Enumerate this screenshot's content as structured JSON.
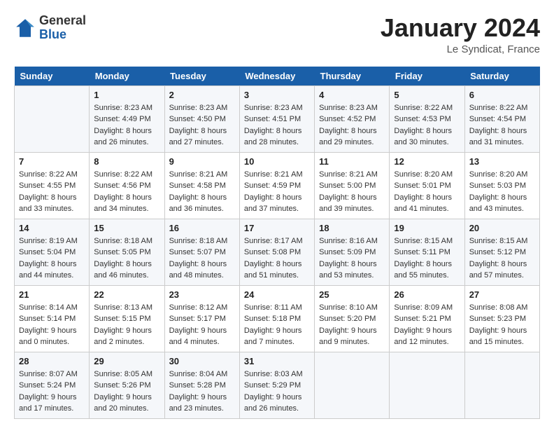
{
  "header": {
    "logo_general": "General",
    "logo_blue": "Blue",
    "month_title": "January 2024",
    "location": "Le Syndicat, France"
  },
  "weekdays": [
    "Sunday",
    "Monday",
    "Tuesday",
    "Wednesday",
    "Thursday",
    "Friday",
    "Saturday"
  ],
  "weeks": [
    [
      {
        "day": "",
        "sunrise": "",
        "sunset": "",
        "daylight": ""
      },
      {
        "day": "1",
        "sunrise": "Sunrise: 8:23 AM",
        "sunset": "Sunset: 4:49 PM",
        "daylight": "Daylight: 8 hours and 26 minutes."
      },
      {
        "day": "2",
        "sunrise": "Sunrise: 8:23 AM",
        "sunset": "Sunset: 4:50 PM",
        "daylight": "Daylight: 8 hours and 27 minutes."
      },
      {
        "day": "3",
        "sunrise": "Sunrise: 8:23 AM",
        "sunset": "Sunset: 4:51 PM",
        "daylight": "Daylight: 8 hours and 28 minutes."
      },
      {
        "day": "4",
        "sunrise": "Sunrise: 8:23 AM",
        "sunset": "Sunset: 4:52 PM",
        "daylight": "Daylight: 8 hours and 29 minutes."
      },
      {
        "day": "5",
        "sunrise": "Sunrise: 8:22 AM",
        "sunset": "Sunset: 4:53 PM",
        "daylight": "Daylight: 8 hours and 30 minutes."
      },
      {
        "day": "6",
        "sunrise": "Sunrise: 8:22 AM",
        "sunset": "Sunset: 4:54 PM",
        "daylight": "Daylight: 8 hours and 31 minutes."
      }
    ],
    [
      {
        "day": "7",
        "sunrise": "Sunrise: 8:22 AM",
        "sunset": "Sunset: 4:55 PM",
        "daylight": "Daylight: 8 hours and 33 minutes."
      },
      {
        "day": "8",
        "sunrise": "Sunrise: 8:22 AM",
        "sunset": "Sunset: 4:56 PM",
        "daylight": "Daylight: 8 hours and 34 minutes."
      },
      {
        "day": "9",
        "sunrise": "Sunrise: 8:21 AM",
        "sunset": "Sunset: 4:58 PM",
        "daylight": "Daylight: 8 hours and 36 minutes."
      },
      {
        "day": "10",
        "sunrise": "Sunrise: 8:21 AM",
        "sunset": "Sunset: 4:59 PM",
        "daylight": "Daylight: 8 hours and 37 minutes."
      },
      {
        "day": "11",
        "sunrise": "Sunrise: 8:21 AM",
        "sunset": "Sunset: 5:00 PM",
        "daylight": "Daylight: 8 hours and 39 minutes."
      },
      {
        "day": "12",
        "sunrise": "Sunrise: 8:20 AM",
        "sunset": "Sunset: 5:01 PM",
        "daylight": "Daylight: 8 hours and 41 minutes."
      },
      {
        "day": "13",
        "sunrise": "Sunrise: 8:20 AM",
        "sunset": "Sunset: 5:03 PM",
        "daylight": "Daylight: 8 hours and 43 minutes."
      }
    ],
    [
      {
        "day": "14",
        "sunrise": "Sunrise: 8:19 AM",
        "sunset": "Sunset: 5:04 PM",
        "daylight": "Daylight: 8 hours and 44 minutes."
      },
      {
        "day": "15",
        "sunrise": "Sunrise: 8:18 AM",
        "sunset": "Sunset: 5:05 PM",
        "daylight": "Daylight: 8 hours and 46 minutes."
      },
      {
        "day": "16",
        "sunrise": "Sunrise: 8:18 AM",
        "sunset": "Sunset: 5:07 PM",
        "daylight": "Daylight: 8 hours and 48 minutes."
      },
      {
        "day": "17",
        "sunrise": "Sunrise: 8:17 AM",
        "sunset": "Sunset: 5:08 PM",
        "daylight": "Daylight: 8 hours and 51 minutes."
      },
      {
        "day": "18",
        "sunrise": "Sunrise: 8:16 AM",
        "sunset": "Sunset: 5:09 PM",
        "daylight": "Daylight: 8 hours and 53 minutes."
      },
      {
        "day": "19",
        "sunrise": "Sunrise: 8:15 AM",
        "sunset": "Sunset: 5:11 PM",
        "daylight": "Daylight: 8 hours and 55 minutes."
      },
      {
        "day": "20",
        "sunrise": "Sunrise: 8:15 AM",
        "sunset": "Sunset: 5:12 PM",
        "daylight": "Daylight: 8 hours and 57 minutes."
      }
    ],
    [
      {
        "day": "21",
        "sunrise": "Sunrise: 8:14 AM",
        "sunset": "Sunset: 5:14 PM",
        "daylight": "Daylight: 9 hours and 0 minutes."
      },
      {
        "day": "22",
        "sunrise": "Sunrise: 8:13 AM",
        "sunset": "Sunset: 5:15 PM",
        "daylight": "Daylight: 9 hours and 2 minutes."
      },
      {
        "day": "23",
        "sunrise": "Sunrise: 8:12 AM",
        "sunset": "Sunset: 5:17 PM",
        "daylight": "Daylight: 9 hours and 4 minutes."
      },
      {
        "day": "24",
        "sunrise": "Sunrise: 8:11 AM",
        "sunset": "Sunset: 5:18 PM",
        "daylight": "Daylight: 9 hours and 7 minutes."
      },
      {
        "day": "25",
        "sunrise": "Sunrise: 8:10 AM",
        "sunset": "Sunset: 5:20 PM",
        "daylight": "Daylight: 9 hours and 9 minutes."
      },
      {
        "day": "26",
        "sunrise": "Sunrise: 8:09 AM",
        "sunset": "Sunset: 5:21 PM",
        "daylight": "Daylight: 9 hours and 12 minutes."
      },
      {
        "day": "27",
        "sunrise": "Sunrise: 8:08 AM",
        "sunset": "Sunset: 5:23 PM",
        "daylight": "Daylight: 9 hours and 15 minutes."
      }
    ],
    [
      {
        "day": "28",
        "sunrise": "Sunrise: 8:07 AM",
        "sunset": "Sunset: 5:24 PM",
        "daylight": "Daylight: 9 hours and 17 minutes."
      },
      {
        "day": "29",
        "sunrise": "Sunrise: 8:05 AM",
        "sunset": "Sunset: 5:26 PM",
        "daylight": "Daylight: 9 hours and 20 minutes."
      },
      {
        "day": "30",
        "sunrise": "Sunrise: 8:04 AM",
        "sunset": "Sunset: 5:28 PM",
        "daylight": "Daylight: 9 hours and 23 minutes."
      },
      {
        "day": "31",
        "sunrise": "Sunrise: 8:03 AM",
        "sunset": "Sunset: 5:29 PM",
        "daylight": "Daylight: 9 hours and 26 minutes."
      },
      {
        "day": "",
        "sunrise": "",
        "sunset": "",
        "daylight": ""
      },
      {
        "day": "",
        "sunrise": "",
        "sunset": "",
        "daylight": ""
      },
      {
        "day": "",
        "sunrise": "",
        "sunset": "",
        "daylight": ""
      }
    ]
  ]
}
